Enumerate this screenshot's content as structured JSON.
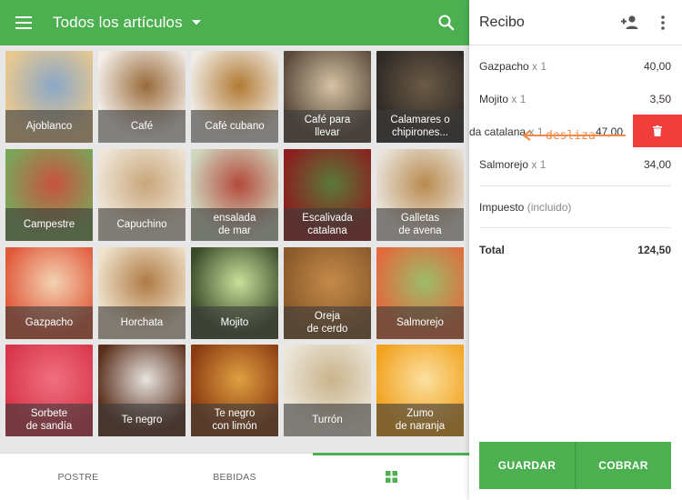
{
  "header": {
    "title": "Todos los artículos"
  },
  "tiles": [
    {
      "label": "Ajoblanco",
      "colors": [
        "#e9c98f",
        "#8aa7c7"
      ]
    },
    {
      "label": "Café",
      "colors": [
        "#f3eee8",
        "#9a6a3a"
      ]
    },
    {
      "label": "Café cubano",
      "colors": [
        "#f1ede6",
        "#b17a33"
      ]
    },
    {
      "label": "Café para\nllevar",
      "colors": [
        "#5a4a3c",
        "#d5c3a3"
      ]
    },
    {
      "label": "Calamares o\nchipirones...",
      "colors": [
        "#2f2a26",
        "#6b5a45"
      ]
    },
    {
      "label": "Campestre",
      "colors": [
        "#7aa65a",
        "#c8533e"
      ]
    },
    {
      "label": "Capuchino",
      "colors": [
        "#efe6d8",
        "#c9a67a"
      ]
    },
    {
      "label": "ensalada\nde mar",
      "colors": [
        "#cfd7c0",
        "#b44a3a"
      ]
    },
    {
      "label": "Escalivada\ncatalana",
      "colors": [
        "#8b1e1e",
        "#5a7a3a"
      ]
    },
    {
      "label": "Galletas\nde avena",
      "colors": [
        "#e9e4dc",
        "#b98a4e"
      ]
    },
    {
      "label": "Gazpacho",
      "colors": [
        "#e0593a",
        "#f3d3b3"
      ]
    },
    {
      "label": "Horchata",
      "colors": [
        "#efe3cc",
        "#b07a44"
      ]
    },
    {
      "label": "Mojito",
      "colors": [
        "#3a4a2a",
        "#c9e09a"
      ]
    },
    {
      "label": "Oreja\nde cerdo",
      "colors": [
        "#8a5a2a",
        "#c58a4a"
      ]
    },
    {
      "label": "Salmorejo",
      "colors": [
        "#e26a3c",
        "#9bbd6a"
      ]
    },
    {
      "label": "Sorbete\nde sandía",
      "colors": [
        "#d8364a",
        "#f07080"
      ]
    },
    {
      "label": "Te negro",
      "colors": [
        "#5a2e1a",
        "#e7e3df"
      ]
    },
    {
      "label": "Te negro\ncon limón",
      "colors": [
        "#8a3a12",
        "#e0a040"
      ]
    },
    {
      "label": "Turrón",
      "colors": [
        "#ece6da",
        "#c9b38a"
      ]
    },
    {
      "label": "Zumo\nde naranja",
      "colors": [
        "#f2a21e",
        "#fbe0a0"
      ]
    }
  ],
  "bottom_tabs": {
    "tab1": "POSTRE",
    "tab2": "BEBIDAS",
    "tab3_icon": "grid-icon"
  },
  "receipt": {
    "title": "Recibo",
    "items": [
      {
        "name": "Gazpacho",
        "qty": "x 1",
        "price": "40,00"
      },
      {
        "name": "Mojito",
        "qty": "x 1",
        "price": "3,50"
      },
      {
        "name": "da catalana",
        "qty": "x 1",
        "price": "47,00"
      },
      {
        "name": "Salmorejo",
        "qty": "x 1",
        "price": "34,00"
      }
    ],
    "tax_label": "Impuesto",
    "tax_note": "(incluido)",
    "total_label": "Total",
    "total_value": "124,50",
    "swipe_hint": "desliza",
    "save_label": "GUARDAR",
    "charge_label": "COBRAR"
  },
  "colors": {
    "accent": "#4caf50",
    "delete": "#ef3e3b",
    "hint": "#ef8a4a"
  }
}
